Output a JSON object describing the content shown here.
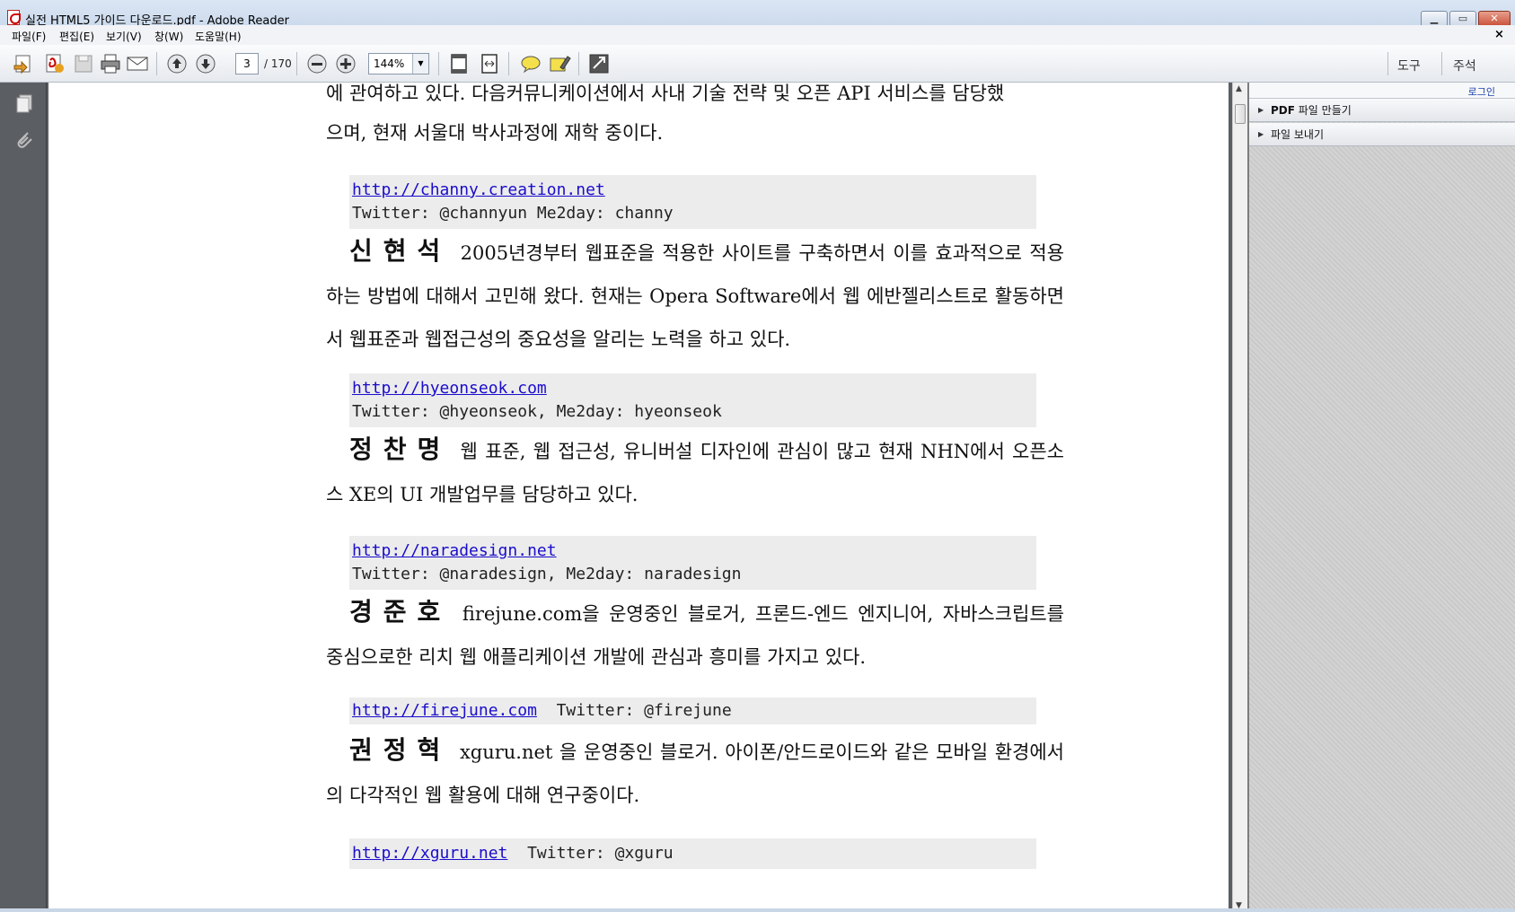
{
  "window": {
    "title": "실전 HTML5 가이드 다운로드.pdf - Adobe Reader",
    "minimize": "▁",
    "maximize": "▭",
    "close": "✕"
  },
  "menu": {
    "items": [
      "파일(F)",
      "편집(E)",
      "보기(V)",
      "창(W)",
      "도움말(H)"
    ],
    "close": "×"
  },
  "toolbar": {
    "current_page": "3",
    "total_pages": "/ 170",
    "zoom": "144%",
    "tools_label": "도구",
    "comment_label": "주석"
  },
  "right_pane": {
    "login": "로그인",
    "items": [
      {
        "bold": "PDF",
        "label": " 파일 만들기"
      },
      {
        "bold": "",
        "label": "파일 보내기"
      }
    ]
  },
  "document": {
    "p0_line1": "에 관여하고 있다. 다음커뮤니케이션에서 사내 기술 전략 및 오픈 API 서비스를 담당했",
    "p0_line2": "으며, 현재 서울대 박사과정에 재학 중이다.",
    "c0_link": "http://channy.creation.net",
    "c0_twitter": "Twitter: @channyun Me2day: channy",
    "p1_name": "신현석",
    "p1_text": "2005년경부터 웹표준을 적용한 사이트를 구축하면서 이를 효과적으로 적용하는 방법에 대해서 고민해 왔다. 현재는 Opera Software에서 웹 에반젤리스트로 활동하면서 웹표준과 웹접근성의 중요성을 알리는 노력을 하고 있다.",
    "c1_link": "http://hyeonseok.com",
    "c1_twitter": "Twitter: @hyeonseok, Me2day: hyeonseok",
    "p2_name": "정찬명",
    "p2_text": "웹 표준, 웹 접근성, 유니버설 디자인에 관심이 많고 현재 NHN에서 오픈소스 XE의 UI 개발업무를 담당하고 있다.",
    "c2_link": "http://naradesign.net",
    "c2_twitter": "Twitter: @naradesign, Me2day: naradesign",
    "p3_name": "경준호",
    "p3_text": "firejune.com을 운영중인 블로거, 프론드-엔드 엔지니어, 자바스크립트를 중심으로한 리치 웹 애플리케이션 개발에 관심과 흥미를 가지고 있다.",
    "c3_link": "http://firejune.com",
    "c3_twitter": "Twitter: @firejune",
    "p4_name": "권정혁",
    "p4_text": "xguru.net 을 운영중인 블로거. 아이폰/안드로이드와 같은 모바일 환경에서의 다각적인 웹 활용에 대해 연구중이다.",
    "c4_link": "http://xguru.net",
    "c4_twitter": "Twitter: @xguru"
  }
}
